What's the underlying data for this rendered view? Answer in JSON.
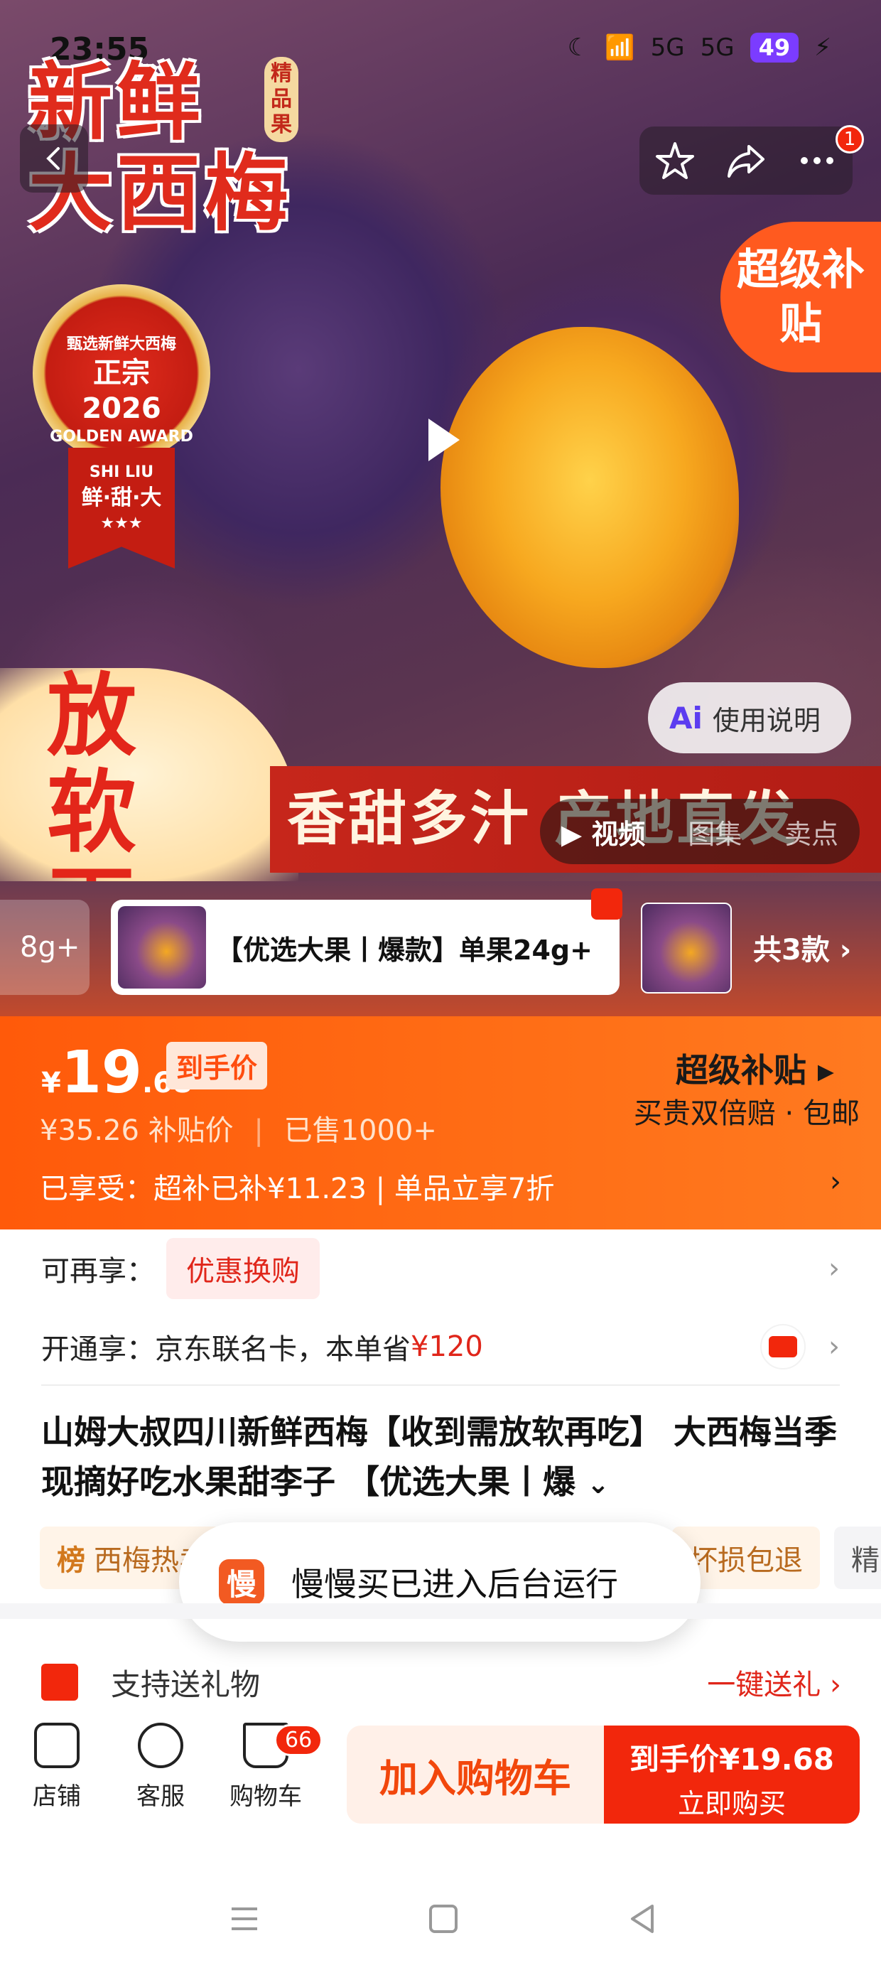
{
  "status_bar": {
    "time": "23:55",
    "network_1": "5G",
    "network_2": "5G",
    "battery": "49"
  },
  "hero": {
    "title_line1": "新鲜",
    "title_line2": "大西梅",
    "title_tag": "精品果",
    "award_top": "甄选新鲜大西梅",
    "award_main": "正宗",
    "award_year": "2026",
    "award_en": "GOLDEN AWARD",
    "award_brand": "SHI LIU",
    "award_ribbon": "鲜·甜·大",
    "award_stars": "★★★",
    "corner_badge": "超级补贴",
    "soft_text": "放软再吃",
    "sweet_text": "香甜多汁  产地直发",
    "usage_button": "使用说明",
    "media_tabs": [
      "视频",
      "图集",
      "卖点"
    ],
    "cart_count_badge": "1"
  },
  "sku": {
    "left_partial": "8g+",
    "main_label": "【优选大果丨爆款】单果24g+",
    "count_label": "共3款"
  },
  "price": {
    "currency": "¥",
    "integer": "19",
    "decimal": ".68",
    "tag": "到手价",
    "original": "¥35.26",
    "original_label": "补贴价",
    "sold": "已售1000+",
    "subsidy_title": "超级补贴",
    "subsidy_sub": "买贵双倍赔 · 包邮",
    "enjoy_line": "已享受：超补已补¥11.23  |  单品立享7折"
  },
  "promos": {
    "extra_label": "可再享：",
    "extra_pill": "优惠换购",
    "open_label": "开通享：京东联名卡，本单省",
    "open_amount": "¥120"
  },
  "product_title": "山姆大叔四川新鲜西梅【收到需放软再吃】 大西梅当季现摘好吃水果甜李子 【优选大果丨爆",
  "tags": {
    "rank_prefix": "榜",
    "rank_text": "西梅热卖",
    "badge_text": "坏损包退",
    "next_text": "精选"
  },
  "toast": {
    "icon_char": "慢",
    "text": "慢慢买已进入后台运行"
  },
  "gift": {
    "label": "支持送礼物",
    "link": "一键送礼 ›"
  },
  "bottom": {
    "store": "店铺",
    "service": "客服",
    "cart": "购物车",
    "cart_badge": "66",
    "add_cart": "加入购物车",
    "buy_line1": "到手价¥19.68",
    "buy_line2": "立即购买"
  }
}
